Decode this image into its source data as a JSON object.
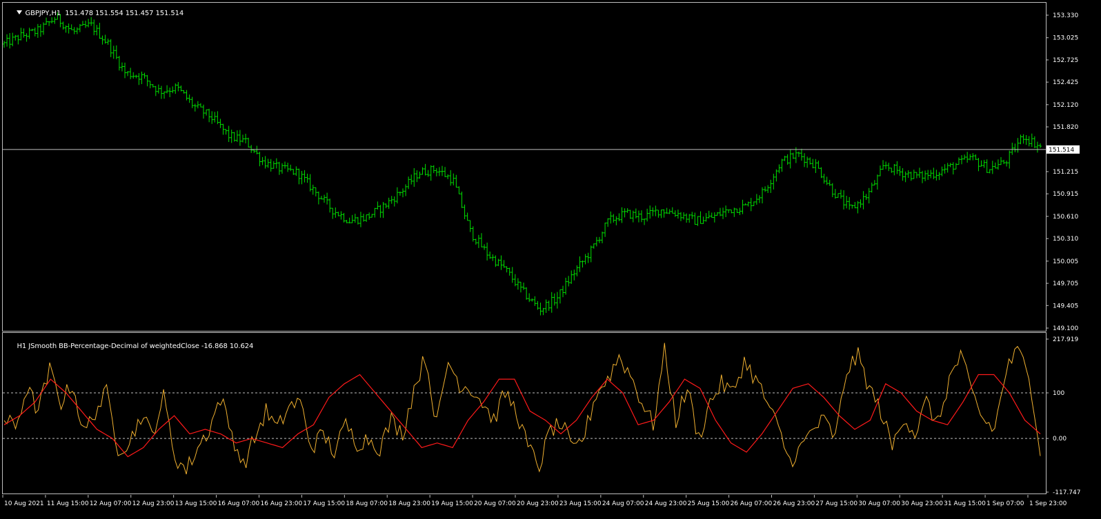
{
  "window": {
    "background": "#000000",
    "axis_color": "#c0c0c0",
    "grid_color": "#c0c0c0"
  },
  "main_chart": {
    "header": "GBPJPY,H1  151.478 151.554 151.457 151.514",
    "symbol": "GBPJPY",
    "timeframe": "H1",
    "ohlc": {
      "open": 151.478,
      "high": 151.554,
      "low": 151.457,
      "close": 151.514
    },
    "bar_color": "#00e000",
    "price_line_color": "#c0c0c0",
    "current_price_label": "151.514",
    "price_ticks": [
      "153.330",
      "153.025",
      "152.725",
      "152.425",
      "152.120",
      "151.820",
      "151.215",
      "150.915",
      "150.610",
      "150.310",
      "150.005",
      "149.705",
      "149.405",
      "149.100"
    ]
  },
  "indicator": {
    "header": "H1 JSmooth BB-Percentage-Decimal of weightedClose -16.868 10.624",
    "name": "JSmooth BB-Percentage-Decimal of weightedClose",
    "values": [
      -16.868,
      10.624
    ],
    "fast_color": "#f0b030",
    "slow_color": "#ff1a1a",
    "level_color": "#c0c0c0",
    "levels": [
      100,
      0
    ],
    "scale_labels": [
      "217.919",
      "100",
      "0.00",
      "-117.747"
    ]
  },
  "time_axis": {
    "labels": [
      "10 Aug 2021",
      "11 Aug 15:00",
      "12 Aug 07:00",
      "12 Aug 23:00",
      "13 Aug 15:00",
      "16 Aug 07:00",
      "16 Aug 23:00",
      "17 Aug 15:00",
      "18 Aug 07:00",
      "18 Aug 23:00",
      "19 Aug 15:00",
      "20 Aug 07:00",
      "20 Aug 23:00",
      "23 Aug 15:00",
      "24 Aug 07:00",
      "24 Aug 23:00",
      "25 Aug 15:00",
      "26 Aug 07:00",
      "26 Aug 23:00",
      "27 Aug 15:00",
      "30 Aug 07:00",
      "30 Aug 23:00",
      "31 Aug 15:00",
      "1 Sep 07:00",
      "1 Sep 23:00"
    ]
  },
  "chart_data": [
    {
      "type": "candlestick-ohlc",
      "title": "GBPJPY,H1",
      "ylim": [
        149.1,
        153.33
      ],
      "current_price": 151.514,
      "x_labels": [
        "10 Aug 2021",
        "11 Aug 15:00",
        "12 Aug 07:00",
        "12 Aug 23:00",
        "13 Aug 15:00",
        "16 Aug 07:00",
        "16 Aug 23:00",
        "17 Aug 15:00",
        "18 Aug 07:00",
        "18 Aug 23:00",
        "19 Aug 15:00",
        "20 Aug 07:00",
        "20 Aug 23:00",
        "23 Aug 15:00",
        "24 Aug 07:00",
        "24 Aug 23:00",
        "25 Aug 15:00",
        "26 Aug 07:00",
        "26 Aug 23:00",
        "27 Aug 15:00",
        "30 Aug 07:00",
        "30 Aug 23:00",
        "31 Aug 15:00",
        "1 Sep 07:00",
        "1 Sep 23:00"
      ],
      "approx_close_path": [
        152.94,
        153.05,
        153.12,
        153.3,
        153.1,
        153.2,
        152.95,
        152.55,
        152.5,
        152.3,
        152.35,
        152.1,
        151.95,
        151.7,
        151.62,
        151.35,
        151.25,
        151.2,
        150.95,
        150.7,
        150.55,
        150.6,
        150.75,
        150.95,
        151.2,
        151.25,
        151.1,
        150.4,
        150.1,
        149.9,
        149.6,
        149.35,
        149.5,
        149.85,
        150.15,
        150.55,
        150.65,
        150.6,
        150.7,
        150.65,
        150.55,
        150.6,
        150.7,
        150.75,
        150.95,
        151.35,
        151.45,
        151.3,
        150.95,
        150.7,
        150.9,
        151.3,
        151.2,
        151.15,
        151.2,
        151.3,
        151.4,
        151.25,
        151.35,
        151.7,
        151.55
      ]
    },
    {
      "type": "line",
      "title": "H1 JSmooth BB-Percentage-Decimal of weightedClose",
      "ylim": [
        -117.747,
        217.919
      ],
      "levels": [
        100,
        0
      ],
      "series": [
        {
          "name": "fast",
          "values": [
            40,
            25,
            110,
            60,
            150,
            80,
            120,
            10,
            60,
            100,
            -20,
            -10,
            50,
            10,
            90,
            -40,
            -70,
            -20,
            20,
            90,
            10,
            -60,
            0,
            60,
            20,
            70,
            80,
            -20,
            10,
            -30,
            30,
            -10,
            0,
            -20,
            40,
            10,
            110,
            180,
            30,
            170,
            120,
            110,
            80,
            40,
            100,
            60,
            -20,
            -60,
            20,
            30,
            -30,
            10,
            100,
            130,
            180,
            140,
            80,
            30,
            190,
            40,
            110,
            0,
            80,
            120,
            100,
            170,
            130,
            80,
            20,
            -50,
            -20,
            20,
            40,
            0,
            150,
            180,
            110,
            60,
            -20,
            50,
            10,
            80,
            30,
            130,
            180,
            100,
            40,
            20,
            150,
            190,
            150,
            -30
          ]
        },
        {
          "name": "smooth",
          "values": [
            30,
            50,
            80,
            130,
            100,
            60,
            20,
            0,
            -40,
            -20,
            20,
            50,
            10,
            20,
            10,
            -10,
            0,
            -10,
            -20,
            10,
            30,
            90,
            120,
            140,
            100,
            60,
            20,
            -20,
            -10,
            -20,
            40,
            80,
            130,
            130,
            60,
            40,
            10,
            40,
            90,
            130,
            100,
            30,
            40,
            80,
            130,
            110,
            40,
            -10,
            -30,
            10,
            60,
            110,
            120,
            90,
            50,
            20,
            40,
            120,
            100,
            60,
            40,
            30,
            80,
            140,
            140,
            100,
            40,
            10
          ]
        }
      ]
    }
  ]
}
